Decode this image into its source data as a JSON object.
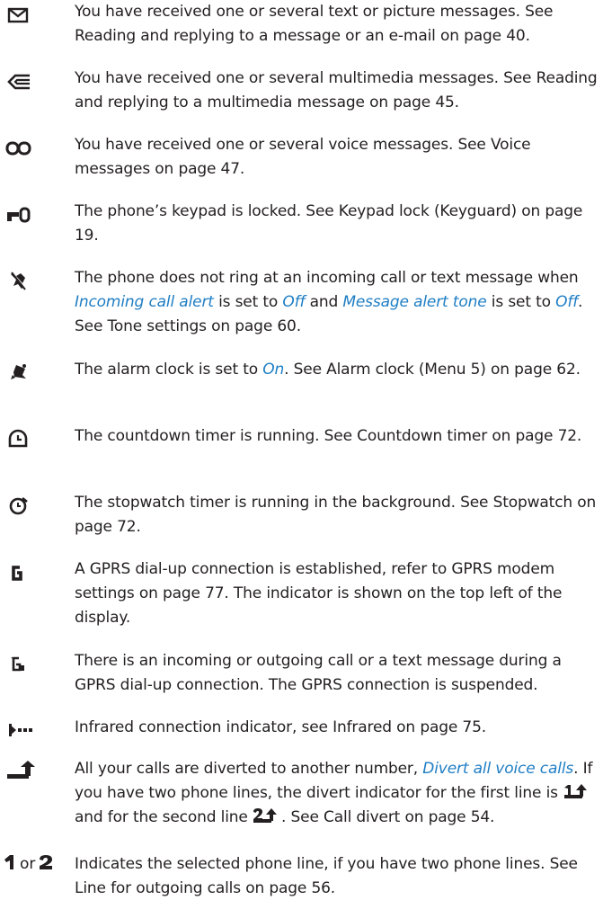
{
  "entries": [
    {
      "icon": "envelope-icon",
      "text": "You have received one or several text or picture messages. See Reading and replying to a message or an e-mail on page 40."
    },
    {
      "icon": "multimedia-message-icon",
      "text": "You have received one or several multimedia messages. See Reading and replying to a multimedia message on page 45."
    },
    {
      "icon": "voicemail-icon",
      "text": "You have received one or several voice messages. See Voice messages on page 47."
    },
    {
      "icon": "keyguard-icon",
      "text": "The phone’s keypad is locked. See Keypad lock (Keyguard) on page 19."
    },
    {
      "icon": "silent-bell-icon",
      "p1": "The phone does not ring at an incoming call or text message when ",
      "t1": "Incoming call alert",
      "p2": " is set to ",
      "t2": "Off",
      "p3": " and ",
      "t3": "Message alert tone",
      "p4": " is set to ",
      "t4": "Off",
      "p5": ". See Tone settings on page 60."
    },
    {
      "icon": "alarm-bell-icon",
      "p1": "The alarm clock is set to ",
      "t1": "On",
      "p2": ". See Alarm clock (Menu 5) on page 62."
    },
    {
      "icon": "countdown-timer-icon",
      "text": "The countdown timer is running. See Countdown timer on page 72."
    },
    {
      "icon": "stopwatch-icon",
      "text": "The stopwatch timer is running in the background. See Stopwatch on page 72."
    },
    {
      "icon": "gprs-icon",
      "text": "A GPRS dial-up connection is established, refer to GPRS modem settings on page 77. The indicator is shown on the top left of the display."
    },
    {
      "icon": "gprs-suspended-icon",
      "text": "There is an incoming or outgoing call or a text message during a GPRS dial-up connection. The GPRS connection is suspended."
    },
    {
      "icon": "infrared-icon",
      "text": "Infrared connection indicator, see Infrared on page 75."
    },
    {
      "icon": "call-divert-icon",
      "p1": "All your calls are diverted to another number, ",
      "t1": "Divert all voice calls",
      "p2": ". If you have two phone lines, the divert indicator for the first line is ",
      "i1": "divert-line-1-icon",
      "p3": " and for the second line ",
      "i2": "divert-line-2-icon",
      "p4": ". See Call divert on page 54."
    },
    {
      "icon": "phone-line-icon",
      "or": "or",
      "text": "Indicates the selected phone line, if you have two phone lines. See Line for outgoing calls on page 56."
    }
  ]
}
